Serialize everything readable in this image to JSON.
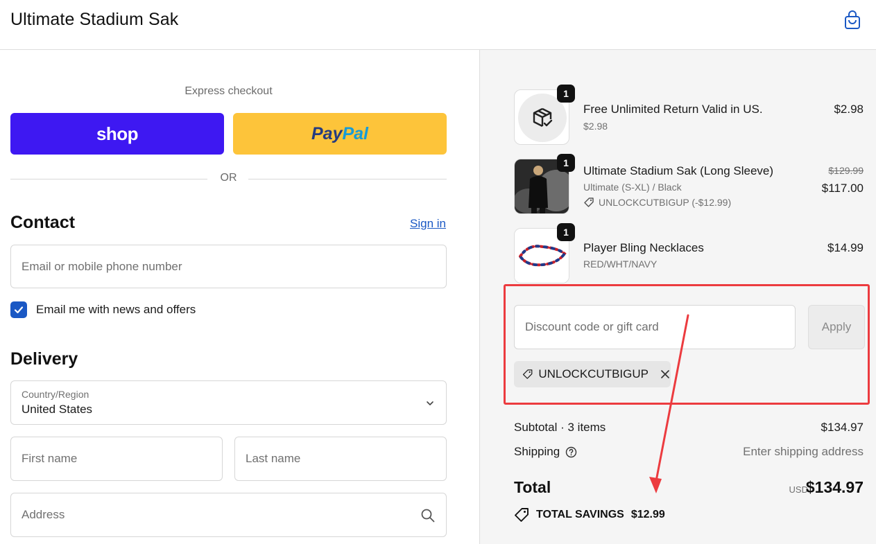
{
  "header": {
    "store_name": "Ultimate Stadium Sak",
    "cart_icon": "shopping-bag-icon"
  },
  "express": {
    "title": "Express checkout",
    "shop_label": "shop",
    "paypal_label_a": "Pay",
    "paypal_label_b": "Pal",
    "or_label": "OR",
    "colors": {
      "shop": "#3e18f2",
      "paypal": "#fdc43a"
    }
  },
  "contact": {
    "title": "Contact",
    "sign_in": "Sign in",
    "email_placeholder": "Email or mobile phone number",
    "newsletter_label": "Email me with news and offers",
    "newsletter_checked": true
  },
  "delivery": {
    "title": "Delivery",
    "country_label": "Country/Region",
    "country_value": "United States",
    "first_name_placeholder": "First name",
    "last_name_placeholder": "Last name",
    "address_placeholder": "Address"
  },
  "order": {
    "items": [
      {
        "name": "Free Unlimited Return Valid in US.",
        "sub": "$2.98",
        "price": "$2.98",
        "qty": "1",
        "thumb_icon": "package-return-icon"
      },
      {
        "name": "Ultimate Stadium Sak (Long Sleeve)",
        "sub": "Ultimate (S-XL) / Black",
        "original_price": "$129.99",
        "price": "$117.00",
        "discount": "UNLOCKCUTBIGUP (-$12.99)",
        "qty": "1",
        "thumb_icon": "jacket-photo"
      },
      {
        "name": "Player Bling Necklaces",
        "sub": "RED/WHT/NAVY",
        "price": "$14.99",
        "qty": "1",
        "thumb_icon": "necklace-photo"
      }
    ],
    "discount_placeholder": "Discount code or gift card",
    "apply_label": "Apply",
    "applied_code": "UNLOCKCUTBIGUP",
    "subtotal_label": "Subtotal · 3 items",
    "subtotal_value": "$134.97",
    "shipping_label": "Shipping",
    "shipping_value": "Enter shipping address",
    "total_label": "Total",
    "total_currency": "USD",
    "total_value": "$134.97",
    "savings_label": "TOTAL SAVINGS",
    "savings_value": "$12.99",
    "annotation_color": "#ec3b3f"
  }
}
